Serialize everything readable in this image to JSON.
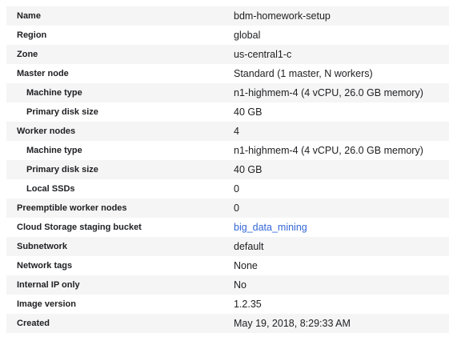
{
  "rows": [
    {
      "label": "Name",
      "value": "bdm-homework-setup"
    },
    {
      "label": "Region",
      "value": "global"
    },
    {
      "label": "Zone",
      "value": "us-central1-c"
    },
    {
      "label": "Master node",
      "value": "Standard (1 master, N workers)"
    },
    {
      "label": "Machine type",
      "value": "n1-highmem-4 (4 vCPU, 26.0 GB memory)"
    },
    {
      "label": "Primary disk size",
      "value": "40 GB"
    },
    {
      "label": "Worker nodes",
      "value": "4"
    },
    {
      "label": "Machine type",
      "value": "n1-highmem-4 (4 vCPU, 26.0 GB memory)"
    },
    {
      "label": "Primary disk size",
      "value": "40 GB"
    },
    {
      "label": "Local SSDs",
      "value": "0"
    },
    {
      "label": "Preemptible worker nodes",
      "value": "0"
    },
    {
      "label": "Cloud Storage staging bucket",
      "value": "big_data_mining"
    },
    {
      "label": "Subnetwork",
      "value": "default"
    },
    {
      "label": "Network tags",
      "value": "None"
    },
    {
      "label": "Internal IP only",
      "value": "No"
    },
    {
      "label": "Image version",
      "value": "1.2.35"
    },
    {
      "label": "Created",
      "value": "May 19, 2018, 8:29:33 AM"
    }
  ],
  "colors": {
    "stripe": "#f5f5f5",
    "link": "#3367d6",
    "text": "#202124"
  }
}
